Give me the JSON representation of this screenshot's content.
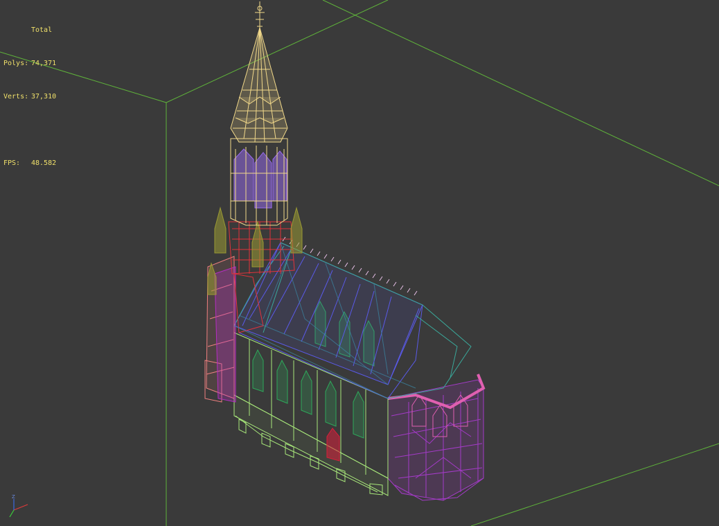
{
  "viewport": {
    "background": "#3a3a3a",
    "grid_color": "#5fb33a",
    "view": "perspective-wireframe"
  },
  "stats": {
    "header": "Total",
    "polys_label": "Polys:",
    "polys_value": "74,371",
    "verts_label": "Verts:",
    "verts_value": "37,310",
    "fps_label": "FPS:",
    "fps_value": "48.582",
    "text_color": "#f0e06a"
  },
  "model": {
    "name_icon": "cathedral-wireframe",
    "colors": {
      "spire": "#f2d98a",
      "spire_inner": "#9a6cf2",
      "tower_red": "#e2333b",
      "tower_pink": "#f08080",
      "tower_magenta": "#b52ec2",
      "pinnacle_olive": "#9a9a33",
      "roof_blue": "#5a5ae8",
      "roof_teal": "#3aa89a",
      "nave_green": "#a8e87a",
      "windows_green": "#2ea85a",
      "apse_purple": "#a43ac8",
      "apse_pink": "#e060b0",
      "door_red": "#d81f3a"
    }
  },
  "axis_gizmo": {
    "z_label": "Z",
    "x_color": "#e03a3a",
    "y_color": "#3ad03a",
    "z_color": "#3a6ae0"
  }
}
